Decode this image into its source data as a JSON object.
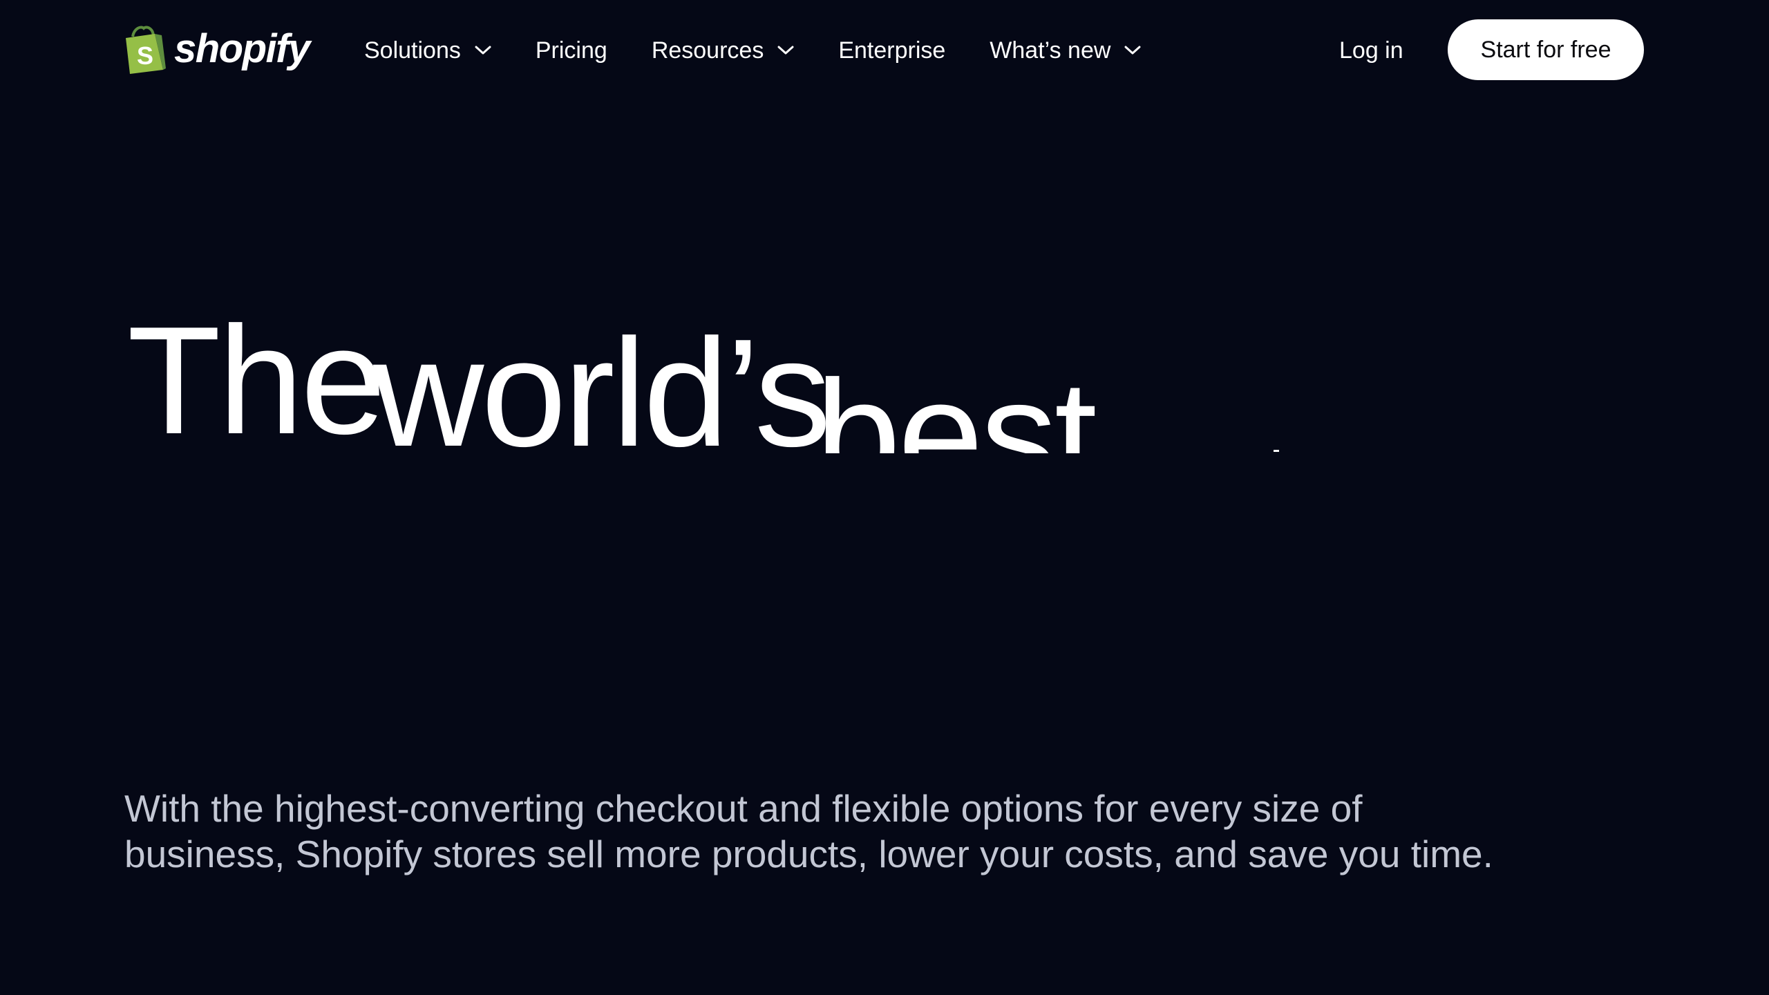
{
  "header": {
    "logo_text": "shopify",
    "nav": [
      {
        "label": "Solutions",
        "has_dropdown": true
      },
      {
        "label": "Pricing",
        "has_dropdown": false
      },
      {
        "label": "Resources",
        "has_dropdown": true
      },
      {
        "label": "Enterprise",
        "has_dropdown": false
      },
      {
        "label": "What’s new",
        "has_dropdown": true
      }
    ],
    "login_label": "Log in",
    "cta_label": "Start for free"
  },
  "hero": {
    "words": [
      "The",
      "world’s",
      "best"
    ]
  },
  "subcopy": "With the highest-converting checkout and flexible options for every size of business, Shopify stores sell more products, lower your costs, and save you time.",
  "colors": {
    "background": "#050816",
    "text": "#ffffff",
    "subtext": "#c3c7d4",
    "cta_bg": "#ffffff",
    "cta_text": "#0b0b0f",
    "logo_bag": "#95bf47"
  },
  "icons": {
    "logo": "shopify-bag-icon",
    "dropdown": "chevron-down-icon"
  }
}
